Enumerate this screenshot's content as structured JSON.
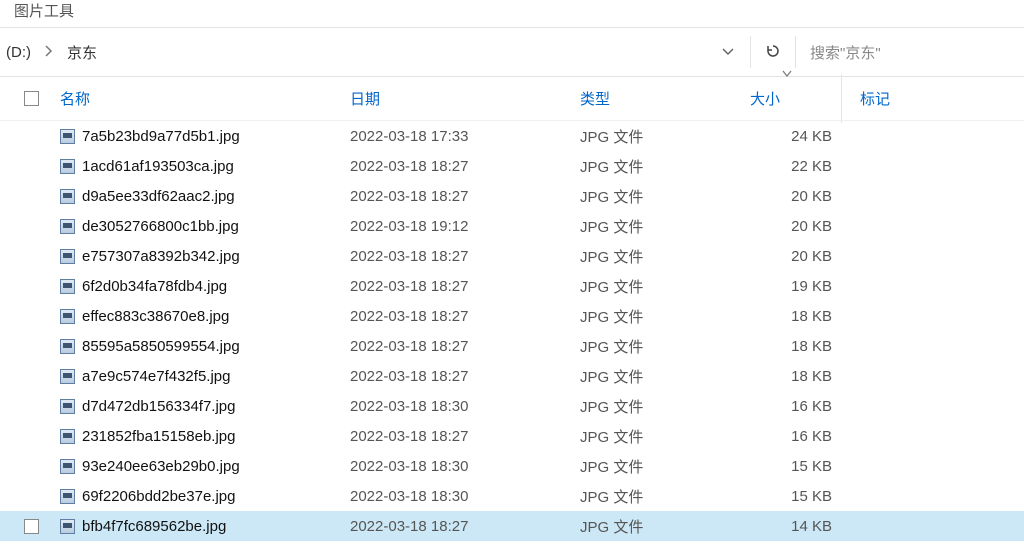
{
  "ribbon_tab": "图片工具",
  "breadcrumb": {
    "drive": "(D:)",
    "folder": "京东"
  },
  "search": {
    "placeholder": "搜索\"京东\""
  },
  "columns": {
    "name": "名称",
    "date": "日期",
    "type": "类型",
    "size": "大小",
    "tags": "标记"
  },
  "files": [
    {
      "name": "7a5b23bd9a77d5b1.jpg",
      "date": "2022-03-18 17:33",
      "type": "JPG 文件",
      "size": "24 KB",
      "selected": false
    },
    {
      "name": "1acd61af193503ca.jpg",
      "date": "2022-03-18 18:27",
      "type": "JPG 文件",
      "size": "22 KB",
      "selected": false
    },
    {
      "name": "d9a5ee33df62aac2.jpg",
      "date": "2022-03-18 18:27",
      "type": "JPG 文件",
      "size": "20 KB",
      "selected": false
    },
    {
      "name": "de3052766800c1bb.jpg",
      "date": "2022-03-18 19:12",
      "type": "JPG 文件",
      "size": "20 KB",
      "selected": false
    },
    {
      "name": "e757307a8392b342.jpg",
      "date": "2022-03-18 18:27",
      "type": "JPG 文件",
      "size": "20 KB",
      "selected": false
    },
    {
      "name": "6f2d0b34fa78fdb4.jpg",
      "date": "2022-03-18 18:27",
      "type": "JPG 文件",
      "size": "19 KB",
      "selected": false
    },
    {
      "name": "effec883c38670e8.jpg",
      "date": "2022-03-18 18:27",
      "type": "JPG 文件",
      "size": "18 KB",
      "selected": false
    },
    {
      "name": "85595a5850599554.jpg",
      "date": "2022-03-18 18:27",
      "type": "JPG 文件",
      "size": "18 KB",
      "selected": false
    },
    {
      "name": "a7e9c574e7f432f5.jpg",
      "date": "2022-03-18 18:27",
      "type": "JPG 文件",
      "size": "18 KB",
      "selected": false
    },
    {
      "name": "d7d472db156334f7.jpg",
      "date": "2022-03-18 18:30",
      "type": "JPG 文件",
      "size": "16 KB",
      "selected": false
    },
    {
      "name": "231852fba15158eb.jpg",
      "date": "2022-03-18 18:27",
      "type": "JPG 文件",
      "size": "16 KB",
      "selected": false
    },
    {
      "name": "93e240ee63eb29b0.jpg",
      "date": "2022-03-18 18:30",
      "type": "JPG 文件",
      "size": "15 KB",
      "selected": false
    },
    {
      "name": "69f2206bdd2be37e.jpg",
      "date": "2022-03-18 18:30",
      "type": "JPG 文件",
      "size": "15 KB",
      "selected": false
    },
    {
      "name": "bfb4f7fc689562be.jpg",
      "date": "2022-03-18 18:27",
      "type": "JPG 文件",
      "size": "14 KB",
      "selected": true
    }
  ]
}
